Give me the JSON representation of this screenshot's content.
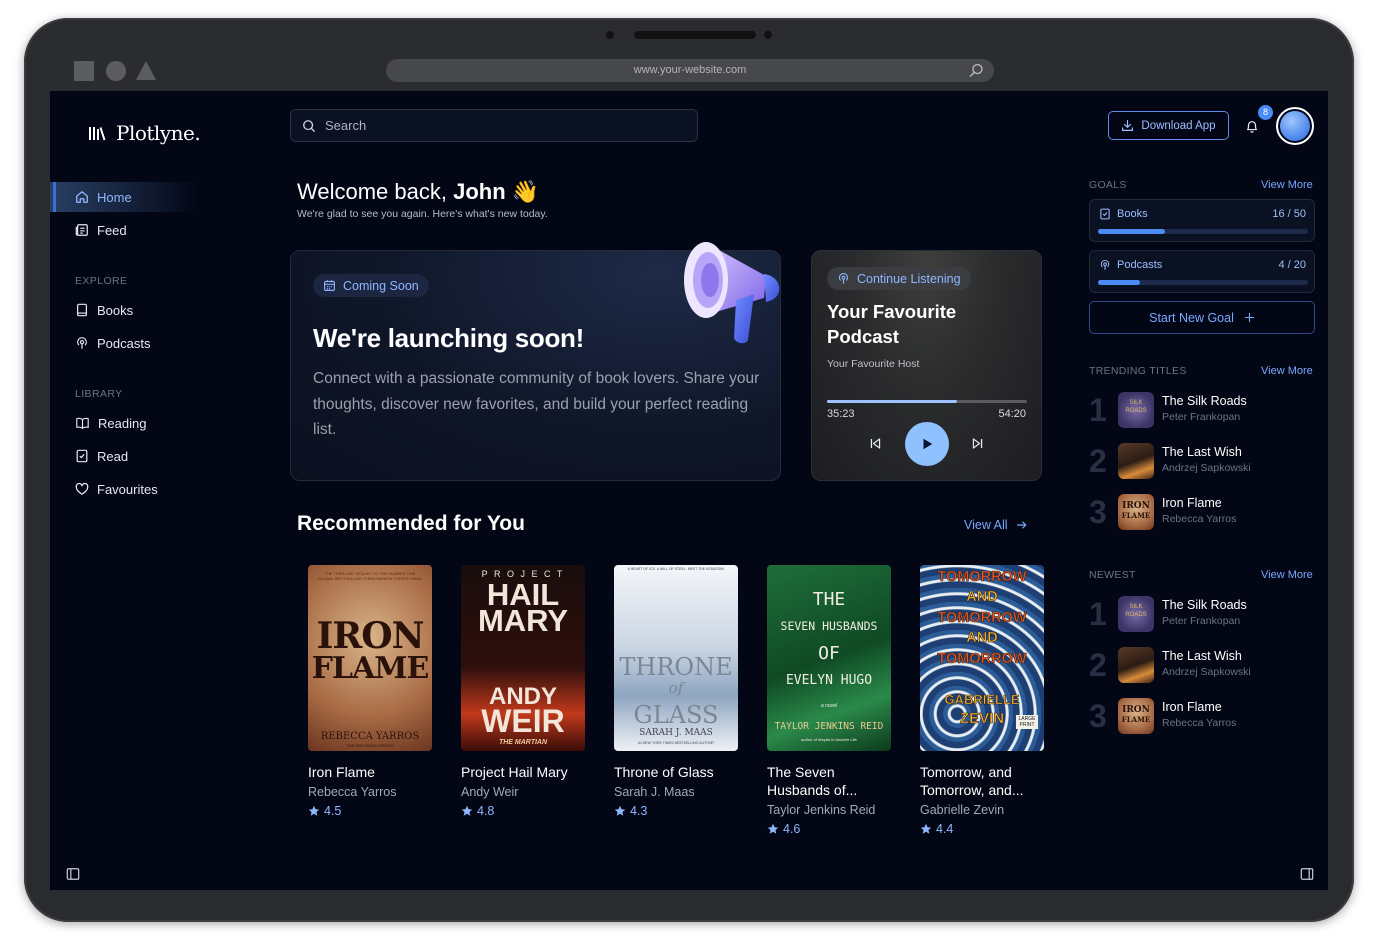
{
  "browser": {
    "url": "www.your-website.com"
  },
  "app": {
    "name": "Plotlyne."
  },
  "sidebar": {
    "main": [
      {
        "label": "Home"
      },
      {
        "label": "Feed"
      }
    ],
    "explore_title": "EXPLORE",
    "explore": [
      {
        "label": "Books"
      },
      {
        "label": "Podcasts"
      }
    ],
    "library_title": "LIBRARY",
    "library": [
      {
        "label": "Reading"
      },
      {
        "label": "Read"
      },
      {
        "label": "Favourites"
      }
    ]
  },
  "header": {
    "search_placeholder": "Search",
    "download_label": "Download App",
    "notification_count": "8"
  },
  "welcome": {
    "greeting": "Welcome back,",
    "name": "John",
    "emoji": "👋",
    "subtitle": "We're glad to see you again. Here's what's new today."
  },
  "hero": {
    "badge": "Coming Soon",
    "title": "We're launching soon!",
    "text": "Connect with a passionate community of book lovers. Share your thoughts, discover new favorites, and build your perfect reading list."
  },
  "podcast": {
    "badge": "Continue Listening",
    "title": "Your Favourite Podcast",
    "host": "Your Favourite Host",
    "elapsed": "35:23",
    "total": "54:20",
    "progress": 0.65
  },
  "recommended": {
    "title": "Recommended for You",
    "view_all": "View All",
    "books": [
      {
        "title": "Iron Flame",
        "author": "Rebecca Yarros",
        "rating": "4.5"
      },
      {
        "title": "Project Hail Mary",
        "author": "Andy Weir",
        "rating": "4.8"
      },
      {
        "title": "Throne of Glass",
        "author": "Sarah J. Maas",
        "rating": "4.3"
      },
      {
        "title": "The Seven Husbands of...",
        "author": "Taylor Jenkins Reid",
        "rating": "4.6"
      },
      {
        "title": "Tomorrow, and Tomorrow, and...",
        "author": "Gabrielle Zevin",
        "rating": "4.4"
      }
    ]
  },
  "covers": {
    "iron_flame": {
      "tagline": "THE THRILLING SEQUEL TO THE NUMBER ONE GLOBAL BESTSELLING PHENOMENON FOURTH WING",
      "line1": "IRON",
      "line2": "FLAME",
      "author": "REBECCA YARROS",
      "series": "THE EMPYREAN SERIES"
    },
    "hail_mary": {
      "line0": "P R O J E C T",
      "line1": "HAIL",
      "line2": "MARY",
      "line3": "ANDY",
      "line4": "WEIR",
      "footer": "THE MARTIAN"
    },
    "throne": {
      "tagline": "A HEART OF ICE. A WILL OF STEEL. MEET THE ASSASSIN.",
      "line1": "THRONE",
      "line2": "of",
      "line3": "GLASS",
      "author": "SARAH J. MAAS",
      "footer": "#1 NEW YORK TIMES BESTSELLING AUTHOR"
    },
    "seven": {
      "line1": "THE",
      "line2": "SEVEN HUSBANDS",
      "line3": "OF",
      "line4": "EVELYN HUGO",
      "novel": "a novel",
      "author": "TAYLOR JENKINS REID",
      "footer": "author of Maybe in Another Life"
    },
    "tomorrow": {
      "line1": "TOMORROW",
      "line2": "AND",
      "line3": "TOMORROW",
      "line4": "AND",
      "line5": "TOMORROW",
      "line6": "GABRIELLE",
      "line7": "ZEVIN",
      "tag": "LARGE PRINT"
    }
  },
  "goals": {
    "title": "GOALS",
    "view_more": "View More",
    "items": [
      {
        "label": "Books",
        "count": "16 / 50",
        "progress": 0.32
      },
      {
        "label": "Podcasts",
        "count": "4 / 20",
        "progress": 0.2
      }
    ],
    "new_goal": "Start New Goal"
  },
  "trending": {
    "title": "TRENDING TITLES",
    "view_more": "View More",
    "items": [
      {
        "rank": "1",
        "title": "The Silk Roads",
        "author": "Peter Frankopan"
      },
      {
        "rank": "2",
        "title": "The Last Wish",
        "author": "Andrzej Sapkowski"
      },
      {
        "rank": "3",
        "title": "Iron Flame",
        "author": "Rebecca Yarros"
      }
    ]
  },
  "newest": {
    "title": "NEWEST",
    "view_more": "View More",
    "items": [
      {
        "rank": "1",
        "title": "The Silk Roads",
        "author": "Peter Frankopan"
      },
      {
        "rank": "2",
        "title": "The Last Wish",
        "author": "Andrzej Sapkowski"
      },
      {
        "rank": "3",
        "title": "Iron Flame",
        "author": "Rebecca Yarros"
      }
    ]
  },
  "thumbs": {
    "silk": {
      "line1": "SILK",
      "line2": "ROADS"
    },
    "iron": {
      "line1": "IRON",
      "line2": "FLAME"
    }
  },
  "colors": {
    "accent": "#4a8bf5",
    "background": "#020615",
    "link": "#7aa8ff"
  }
}
